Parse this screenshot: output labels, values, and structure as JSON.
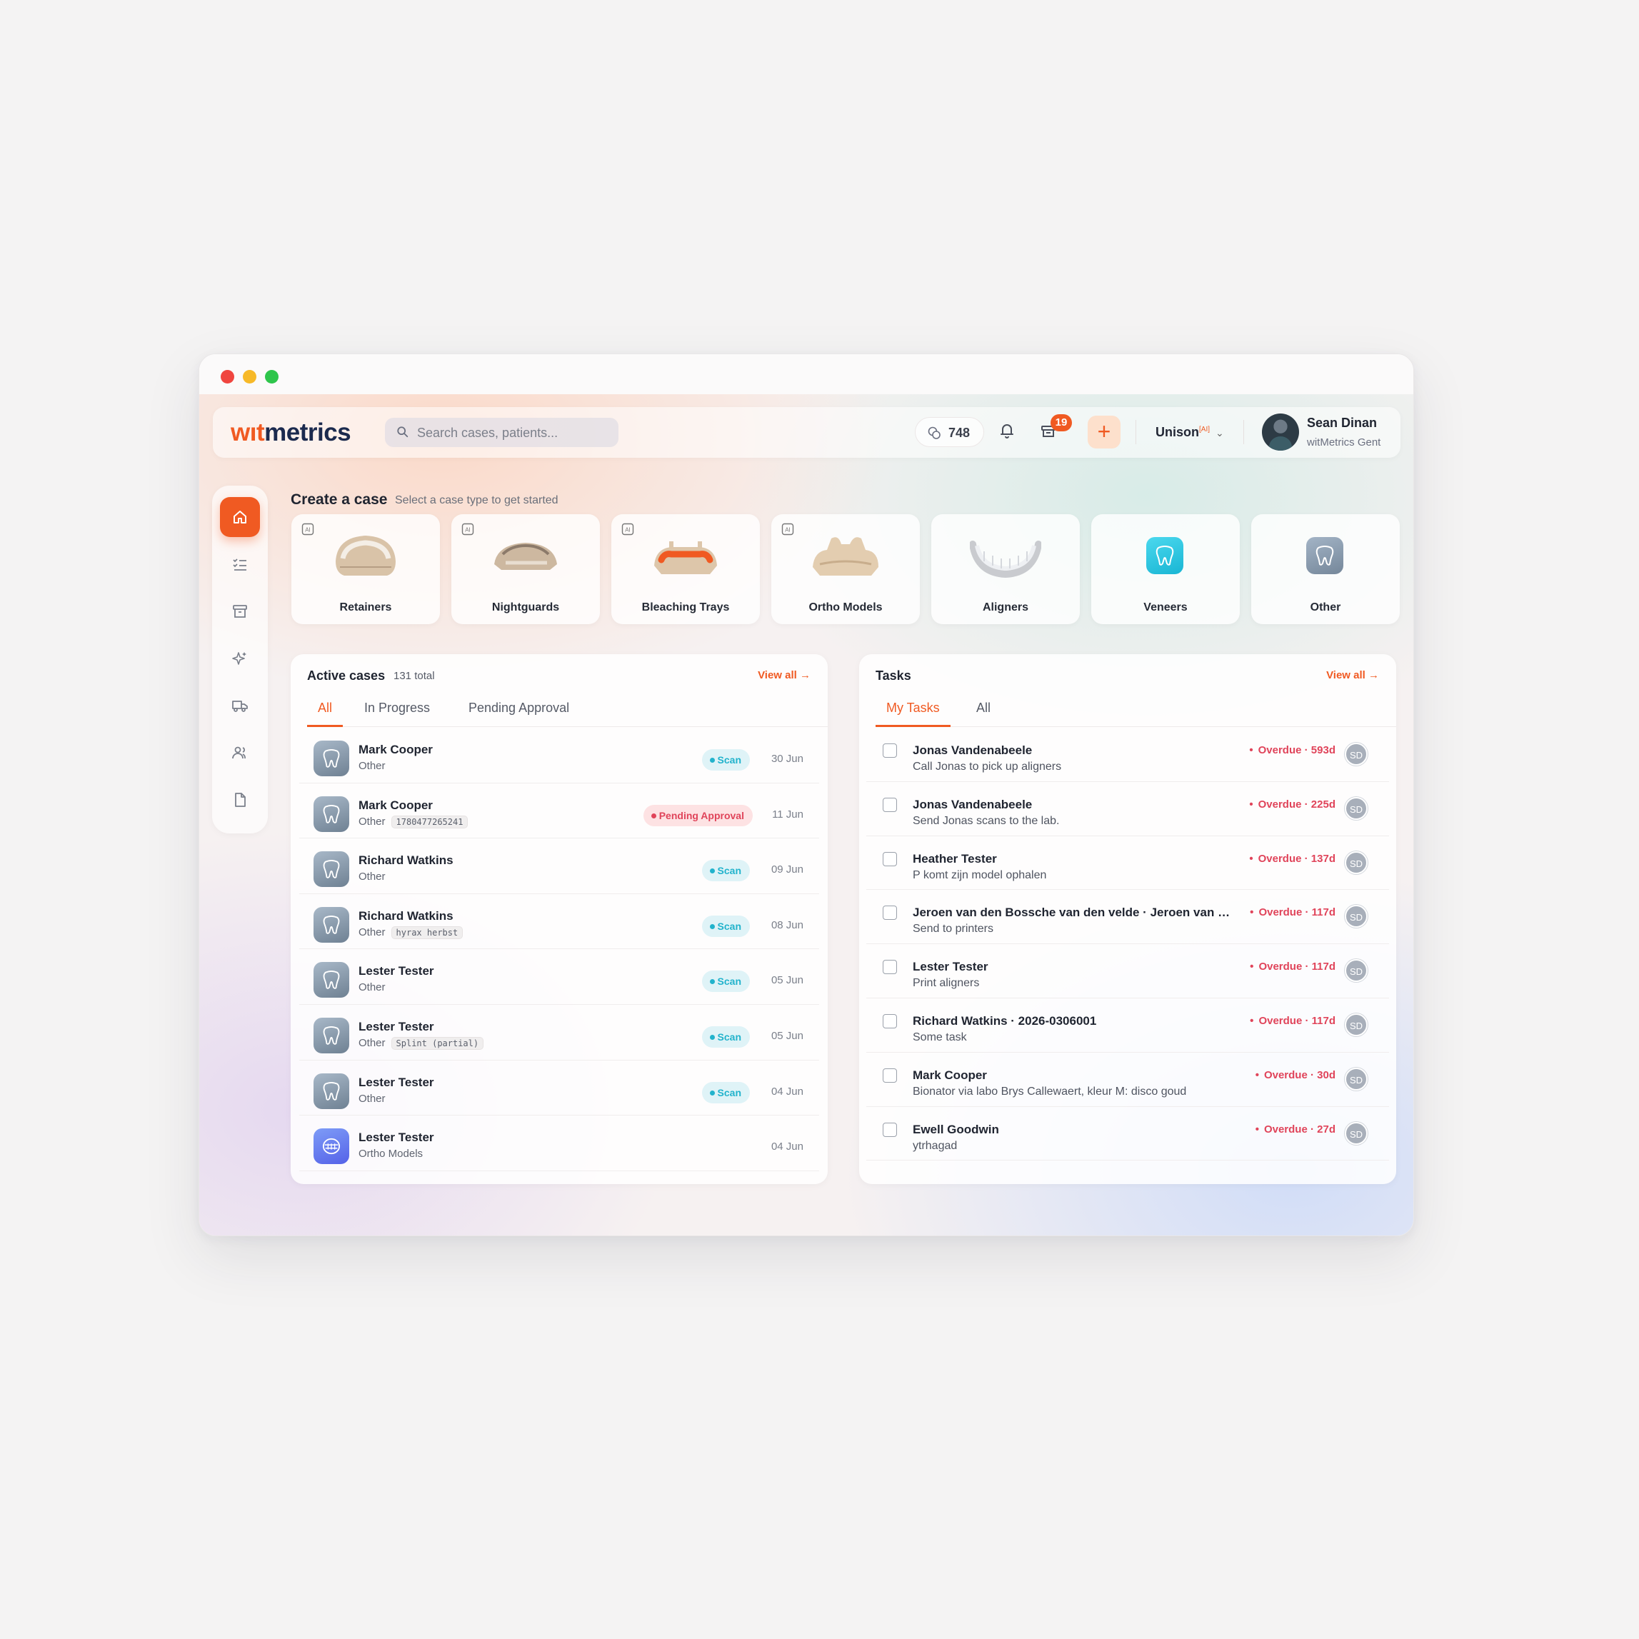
{
  "header": {
    "logo_prefix": "w",
    "logo_mark": "ıt",
    "logo_suffix": "metrics",
    "search_placeholder": "Search cases, patients...",
    "credits": "748",
    "box_badge": "19",
    "add_label": "+",
    "workspace": "Unison",
    "workspace_sup": "[AI]",
    "user_name": "Sean Dinan",
    "user_org": "witMetrics Gent"
  },
  "create": {
    "title": "Create a case",
    "subtitle": "Select a case type to get started",
    "types": [
      {
        "label": "Retainers"
      },
      {
        "label": "Nightguards"
      },
      {
        "label": "Bleaching Trays"
      },
      {
        "label": "Ortho Models"
      },
      {
        "label": "Aligners"
      },
      {
        "label": "Veneers"
      },
      {
        "label": "Other"
      }
    ]
  },
  "active_cases": {
    "title": "Active cases",
    "count": "131 total",
    "view_all": "View all →",
    "tabs": [
      "All",
      "In Progress",
      "Pending Approval"
    ],
    "rows": [
      {
        "name": "Mark Cooper",
        "type": "Other",
        "tag": "",
        "status": "Scan",
        "date": "30 Jun"
      },
      {
        "name": "Mark Cooper",
        "type": "Other",
        "tag": "1780477265241",
        "status": "Pending Approval",
        "date": "11 Jun"
      },
      {
        "name": "Richard Watkins",
        "type": "Other",
        "tag": "",
        "status": "Scan",
        "date": "09 Jun"
      },
      {
        "name": "Richard Watkins",
        "type": "Other",
        "tag": "hyrax herbst",
        "status": "Scan",
        "date": "08 Jun"
      },
      {
        "name": "Lester Tester",
        "type": "Other",
        "tag": "",
        "status": "Scan",
        "date": "05 Jun"
      },
      {
        "name": "Lester Tester",
        "type": "Other",
        "tag": "Splint (partial)",
        "status": "Scan",
        "date": "05 Jun"
      },
      {
        "name": "Lester Tester",
        "type": "Other",
        "tag": "",
        "status": "Scan",
        "date": "04 Jun"
      },
      {
        "name": "Lester Tester",
        "type": "Ortho Models",
        "tag": "",
        "status": "",
        "date": "04 Jun"
      }
    ]
  },
  "tasks": {
    "title": "Tasks",
    "view_all": "View all →",
    "tabs": [
      "My Tasks",
      "All"
    ],
    "rows": [
      {
        "name": "Jonas Vandenabeele",
        "desc": "Call Jonas to pick up aligners",
        "overdue": "Overdue · 593d",
        "assignee": "SD"
      },
      {
        "name": "Jonas Vandenabeele",
        "desc": "Send Jonas scans to the lab.",
        "overdue": "Overdue · 225d",
        "assignee": "SD"
      },
      {
        "name": "Heather Tester",
        "desc": "P komt zijn model ophalen",
        "overdue": "Overdue · 137d",
        "assignee": "SD"
      },
      {
        "name": "Jeroen van den Bossche van den velde · Jeroen van d...",
        "desc": "Send to printers",
        "overdue": "Overdue · 117d",
        "assignee": "SD"
      },
      {
        "name": "Lester Tester",
        "desc": "Print aligners",
        "overdue": "Overdue · 117d",
        "assignee": "SD"
      },
      {
        "name": "Richard Watkins · 2026-0306001",
        "desc": "Some task",
        "overdue": "Overdue · 117d",
        "assignee": "SD"
      },
      {
        "name": "Mark Cooper",
        "desc": "Bionator via labo Brys Callewaert, kleur M: disco goud",
        "overdue": "Overdue · 30d",
        "assignee": "SD"
      },
      {
        "name": "Ewell Goodwin",
        "desc": "ytrhagad",
        "overdue": "Overdue · 27d",
        "assignee": "SD"
      }
    ]
  },
  "colors": {
    "accent": "#f05a22",
    "scan": "#22b3cc",
    "danger": "#e0445a"
  }
}
